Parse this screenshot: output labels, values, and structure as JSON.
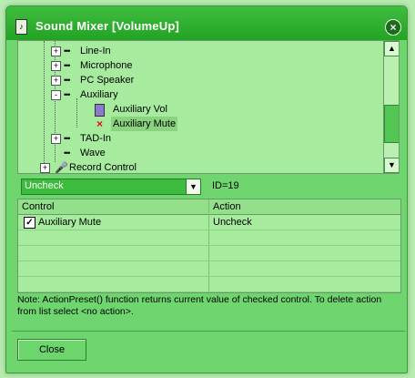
{
  "window": {
    "title": "Sound Mixer [VolumeUp]",
    "title_icon": "speaker-icon",
    "close_icon": "close-icon"
  },
  "tree": {
    "items": [
      {
        "label": "Line-In",
        "expander": "+",
        "icon": "plug-icon"
      },
      {
        "label": "Microphone",
        "expander": "+",
        "icon": "plug-icon"
      },
      {
        "label": "PC Speaker",
        "expander": "+",
        "icon": "plug-icon"
      },
      {
        "label": "Auxiliary",
        "expander": "-",
        "icon": "plug-icon"
      },
      {
        "label": "Auxiliary Vol",
        "expander": "",
        "icon": "volume-control-icon"
      },
      {
        "label": "Auxiliary Mute",
        "expander": "",
        "icon": "mute-x-icon"
      },
      {
        "label": "TAD-In",
        "expander": "+",
        "icon": "plug-icon"
      },
      {
        "label": "Wave",
        "expander": "",
        "icon": "plug-icon"
      },
      {
        "label": "Record Control",
        "expander": "+",
        "icon": "microphone-icon"
      }
    ]
  },
  "action_select": {
    "value": "Uncheck",
    "id_label": "ID=19"
  },
  "grid": {
    "columns": [
      "Control",
      "Action"
    ],
    "rows": [
      {
        "control": "Auxiliary Mute",
        "action": "Uncheck",
        "checked": true
      }
    ]
  },
  "note": "Note: ActionPreset() function returns current value of checked control. To delete action from list select <no action>.",
  "footer": {
    "close_label": "Close"
  },
  "colors": {
    "accent": "#23a323",
    "panel": "#a6eb9e",
    "window": "#6fd66f"
  }
}
